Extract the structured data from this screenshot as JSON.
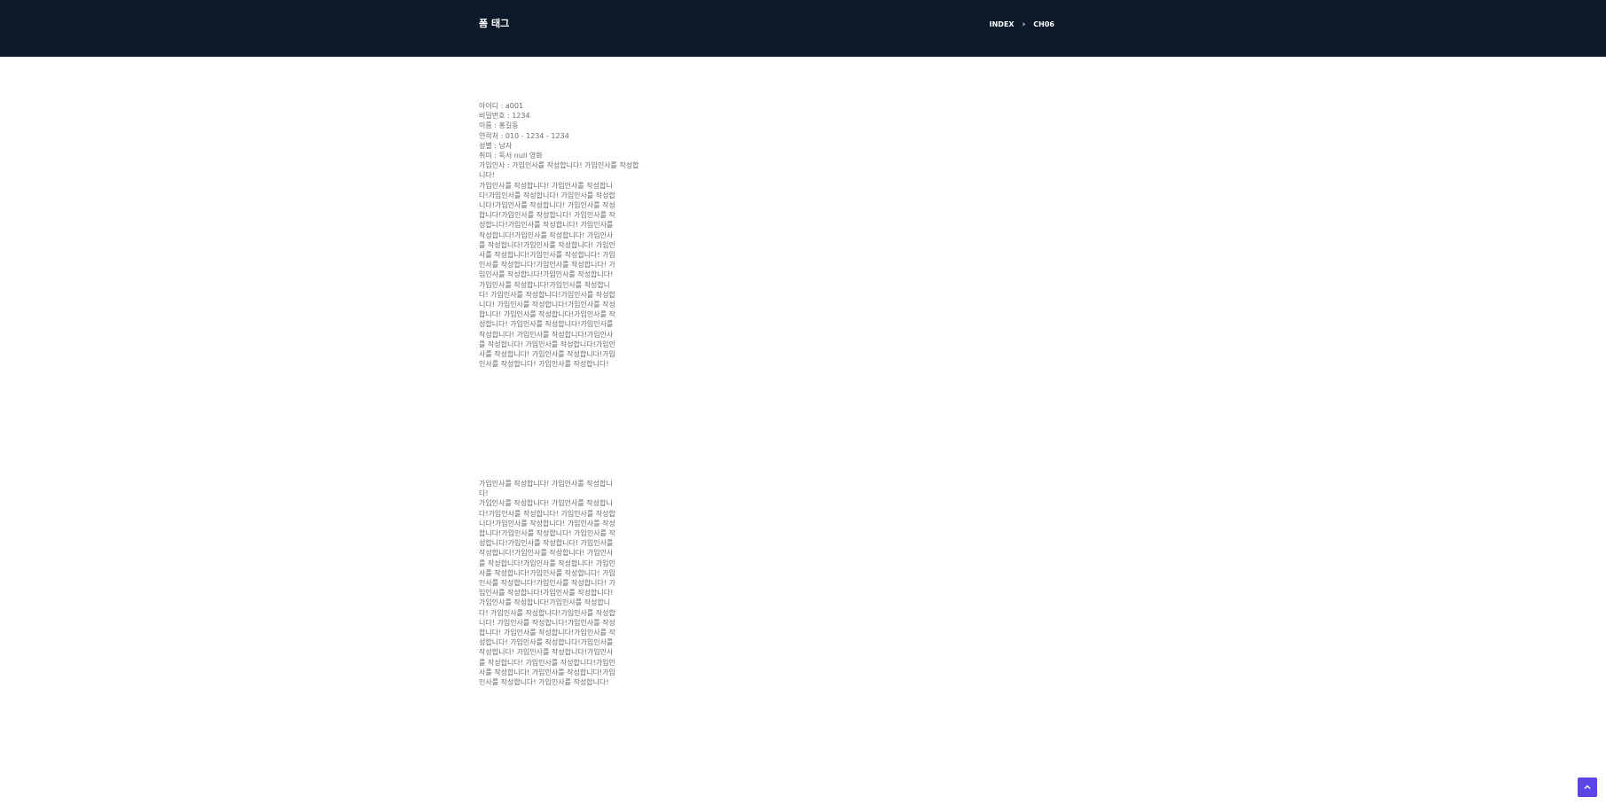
{
  "header": {
    "title": "폼 태그",
    "breadcrumb": [
      "INDEX",
      "CH06"
    ],
    "background_color": "#0c1a2b"
  },
  "member": {
    "id_line": "아이디 : a001",
    "password_line": "비밀번호 : 1234",
    "name_line": "이름 : 홍길동",
    "phone_line": "연락처 : 010 - 1234 - 1234",
    "gender_line": "성별 : 남자",
    "hobby_line": "취미 : 독서 null 영화",
    "greeting_line": "가입인사 : 가입인사를 작성합니다! 가입인사를 작성합니다!",
    "greeting_body": "가입인사를 작성합니다! 가입인사를 작성합니다!가입인사를 작성합니다! 가입인사를 작성합니다!가입인사를 작성합니다! 가입인사를 작성합니다!가입인사를 작성합니다! 가입인사를 작성합니다!가입인사를 작성합니다! 가입인사를 작성합니다!가입인사를 작성합니다! 가입인사를 작성합니다!가입인사를 작성합니다! 가입인사를 작성합니다!가입인사를 작성합니다! 가입인사를 작성합니다!가입인사를 작성합니다! 가입인사를 작성합니다!가입인사를 작성합니다! 가입인사를 작성합니다!가입인사를 작성합니다! 가입인사를 작성합니다!가입인사를 작성합니다! 가입인사를 작성합니다!가입인사를 작성합니다! 가입인사를 작성합니다!가입인사를 작성합니다! 가입인사를 작성합니다!가입인사를 작성합니다! 가입인사를 작성합니다!가입인사를 작성합니다! 가입인사를 작성합니다!가입인사를 작성합니다! 가입인사를 작성합니다!가입인사를 작성합니다! 가입인사를 작성합니다!"
  },
  "second": {
    "first_line": "가입인사를 작성합니다! 가입인사를 작성합니다!",
    "body": "가입인사를 작성합니다! 가입인사를 작성합니다!가입인사를 작성합니다! 가입인사를 작성합니다!가입인사를 작성합니다! 가입인사를 작성합니다!가입인사를 작성합니다! 가입인사를 작성합니다!가입인사를 작성합니다! 가입인사를 작성합니다!가입인사를 작성합니다! 가입인사를 작성합니다!가입인사를 작성합니다! 가입인사를 작성합니다!가입인사를 작성합니다! 가입인사를 작성합니다!가입인사를 작성합니다! 가입인사를 작성합니다!가입인사를 작성합니다! 가입인사를 작성합니다!가입인사를 작성합니다! 가입인사를 작성합니다!가입인사를 작성합니다! 가입인사를 작성합니다!가입인사를 작성합니다! 가입인사를 작성합니다!가입인사를 작성합니다! 가입인사를 작성합니다!가입인사를 작성합니다! 가입인사를 작성합니다!가입인사를 작성합니다! 가입인사를 작성합니다!가입인사를 작성합니다! 가입인사를 작성합니다!가입인사를 작성합니다! 가입인사를 작성합니다!"
  },
  "scroll_top": {
    "icon": "chevron-up-icon",
    "color": "#5b45e6"
  }
}
